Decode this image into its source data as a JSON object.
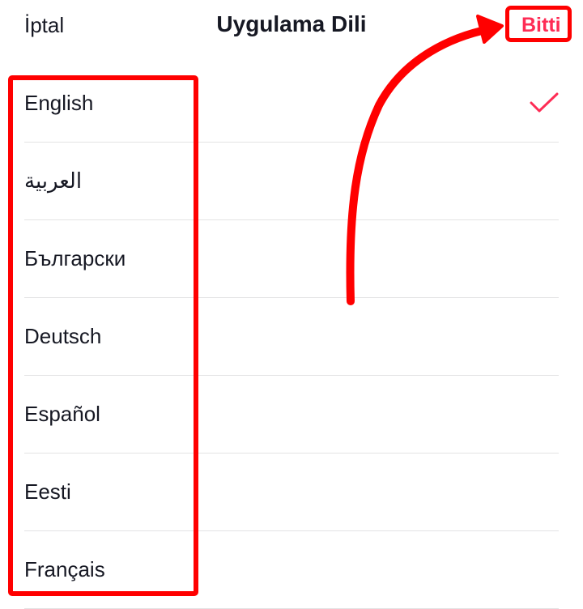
{
  "header": {
    "cancel_label": "İptal",
    "title": "Uygulama Dili",
    "done_label": "Bitti"
  },
  "languages": [
    {
      "label": "English",
      "selected": true
    },
    {
      "label": "العربية",
      "selected": false
    },
    {
      "label": "Български",
      "selected": false
    },
    {
      "label": "Deutsch",
      "selected": false
    },
    {
      "label": "Español",
      "selected": false
    },
    {
      "label": "Eesti",
      "selected": false
    },
    {
      "label": "Français",
      "selected": false
    }
  ],
  "colors": {
    "accent": "#fe2c55",
    "annotation": "#ff0000",
    "text": "#161823",
    "divider": "#e3e3e4"
  },
  "icons": {
    "selected_marker": "checkmark-icon"
  }
}
